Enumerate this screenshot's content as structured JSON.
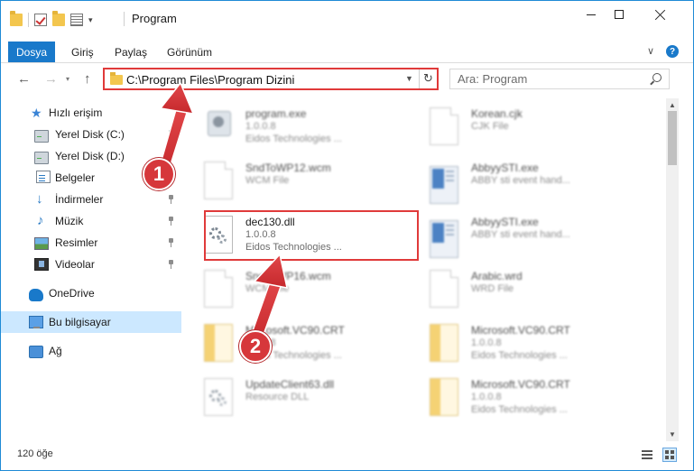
{
  "window": {
    "title": "Program",
    "accent": "#1979ca",
    "highlight_color": "#e03a3a"
  },
  "ribbon": {
    "tabs": [
      "Dosya",
      "Giriş",
      "Paylaş",
      "Görünüm"
    ],
    "help": "?"
  },
  "nav": {
    "address": "C:\\Program Files\\Program Dizini",
    "search_placeholder": "Ara: Program"
  },
  "sidebar": {
    "items": [
      {
        "label": "Hızlı erişim",
        "icon": "star-icon"
      },
      {
        "label": "Yerel Disk (C:)",
        "icon": "disk-icon"
      },
      {
        "label": "Yerel Disk (D:)",
        "icon": "disk-icon"
      },
      {
        "label": "Belgeler",
        "icon": "documents-icon"
      },
      {
        "label": "İndirmeler",
        "icon": "download-icon"
      },
      {
        "label": "Müzik",
        "icon": "music-icon"
      },
      {
        "label": "Resimler",
        "icon": "pictures-icon"
      },
      {
        "label": "Videolar",
        "icon": "video-icon"
      },
      {
        "label": "OneDrive",
        "icon": "cloud-icon"
      },
      {
        "label": "Bu bilgisayar",
        "icon": "computer-icon"
      },
      {
        "label": "Ağ",
        "icon": "network-icon"
      }
    ]
  },
  "files": [
    {
      "name": "program.exe",
      "line1": "1.0.0.8",
      "line2": "Eidos Technologies ...",
      "icon": "program-exe-icon"
    },
    {
      "name": "Korean.cjk",
      "line1": "CJK File",
      "line2": "",
      "icon": "document-icon"
    },
    {
      "name": "SndToWP12.wcm",
      "line1": "WCM File",
      "line2": "",
      "icon": "document-icon"
    },
    {
      "name": "AbbyySTI.exe",
      "line1": "ABBY sti event hand...",
      "line2": "",
      "icon": "exe-icon"
    },
    {
      "name": "dec130.dll",
      "line1": "1.0.0.8",
      "line2": "Eidos Technologies ...",
      "icon": "dll-gear-icon"
    },
    {
      "name": "AbbyySTI.exe",
      "line1": "ABBY sti event hand...",
      "line2": "",
      "icon": "exe-icon"
    },
    {
      "name": "SndToWP16.wcm",
      "line1": "WCM File",
      "line2": "",
      "icon": "document-icon"
    },
    {
      "name": "Arabic.wrd",
      "line1": "WRD File",
      "line2": "",
      "icon": "document-icon"
    },
    {
      "name": "Microsoft.VC90.CRT",
      "line1": "1.0.0.8",
      "line2": "Eidos Technologies ...",
      "icon": "folder-doc-icon"
    },
    {
      "name": "Microsoft.VC90.CRT",
      "line1": "1.0.0.8",
      "line2": "Eidos Technologies ...",
      "icon": "folder-doc-icon"
    },
    {
      "name": "UpdateClient63.dll",
      "line1": "Resource DLL",
      "line2": "",
      "icon": "dll-gear-icon"
    },
    {
      "name": "Microsoft.VC90.CRT",
      "line1": "1.0.0.8",
      "line2": "Eidos Technologies ...",
      "icon": "folder-doc-icon"
    }
  ],
  "annotations": [
    "1",
    "2"
  ],
  "status": {
    "count": "120 öğe"
  }
}
